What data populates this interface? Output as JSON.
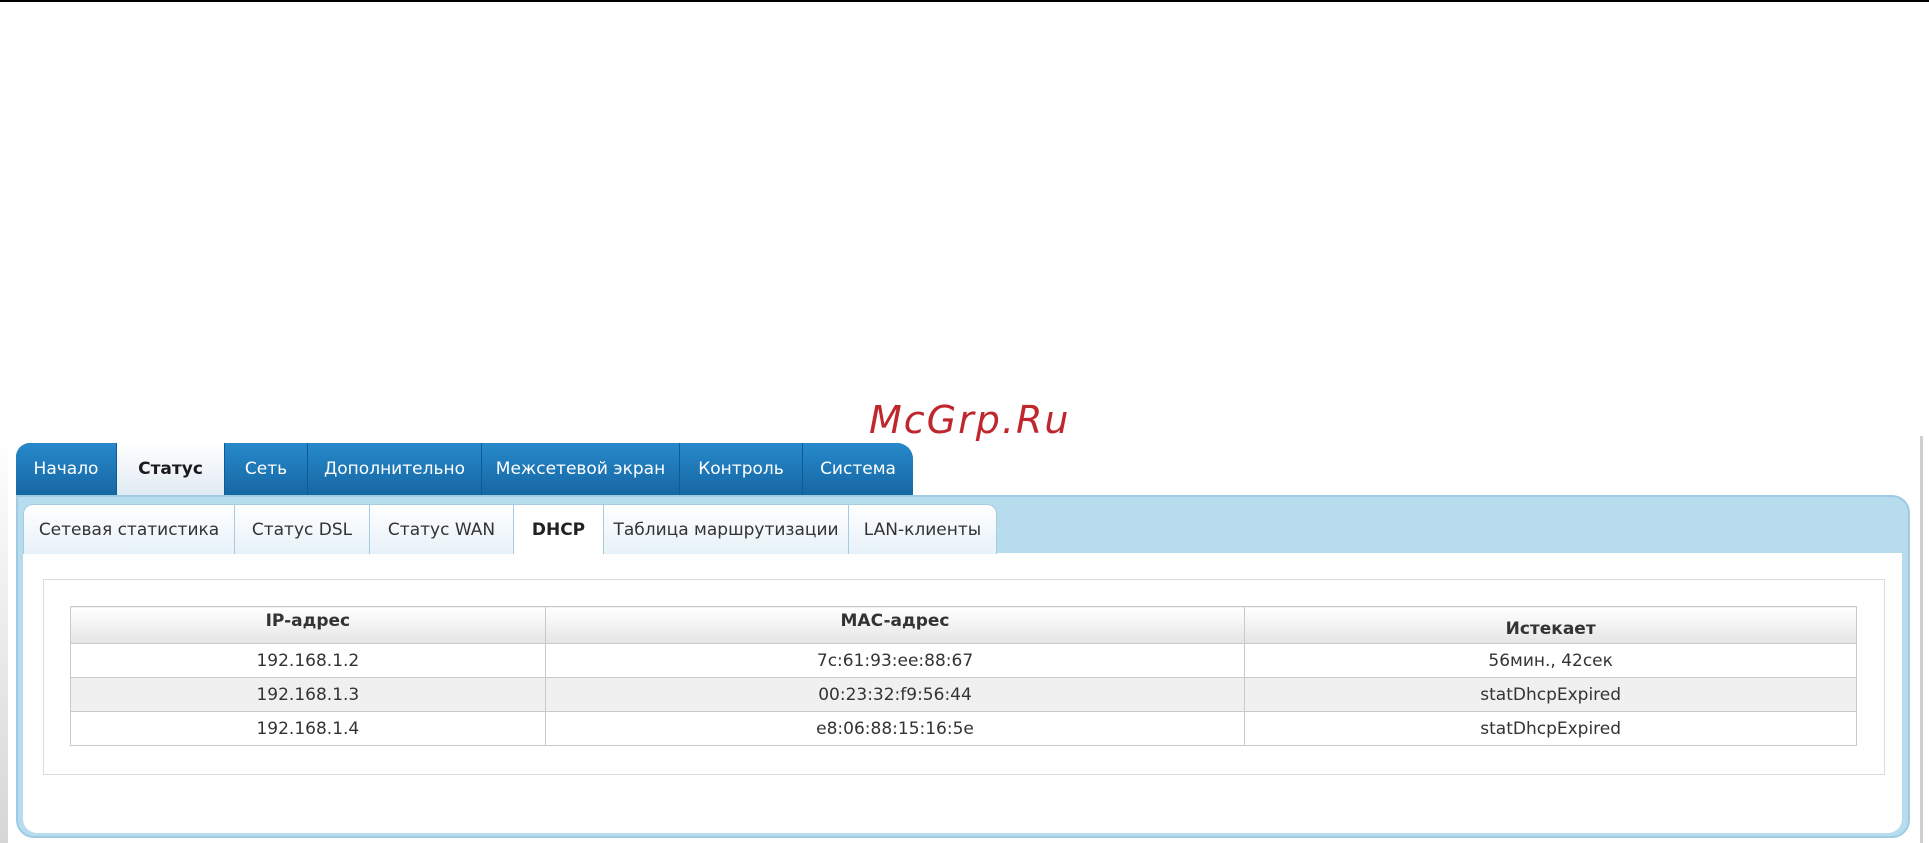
{
  "watermark": "McGrp.Ru",
  "main_tabs": [
    {
      "label": "Начало",
      "active": false
    },
    {
      "label": "Статус",
      "active": true
    },
    {
      "label": "Сеть",
      "active": false
    },
    {
      "label": "Дополнительно",
      "active": false
    },
    {
      "label": "Межсетевой экран",
      "active": false
    },
    {
      "label": "Контроль",
      "active": false
    },
    {
      "label": "Система",
      "active": false
    }
  ],
  "sub_tabs": [
    {
      "label": "Сетевая статистика",
      "active": false
    },
    {
      "label": "Статус DSL",
      "active": false
    },
    {
      "label": "Статус WAN",
      "active": false
    },
    {
      "label": "DHCP",
      "active": true
    },
    {
      "label": "Таблица маршрутизации",
      "active": false
    },
    {
      "label": "LAN-клиенты",
      "active": false
    }
  ],
  "table": {
    "headers": [
      "IP-адрес",
      "MAC-адрес",
      "Истекает"
    ],
    "rows": [
      [
        "192.168.1.2",
        "7c:61:93:ee:88:67",
        "56мин., 42сек"
      ],
      [
        "192.168.1.3",
        "00:23:32:f9:56:44",
        "statDhcpExpired"
      ],
      [
        "192.168.1.4",
        "e8:06:88:15:16:5e",
        "statDhcpExpired"
      ]
    ]
  },
  "colors": {
    "tab_blue": "#1a78ba",
    "panel_blue": "#b7dcee",
    "watermark_red": "#c0272d"
  }
}
